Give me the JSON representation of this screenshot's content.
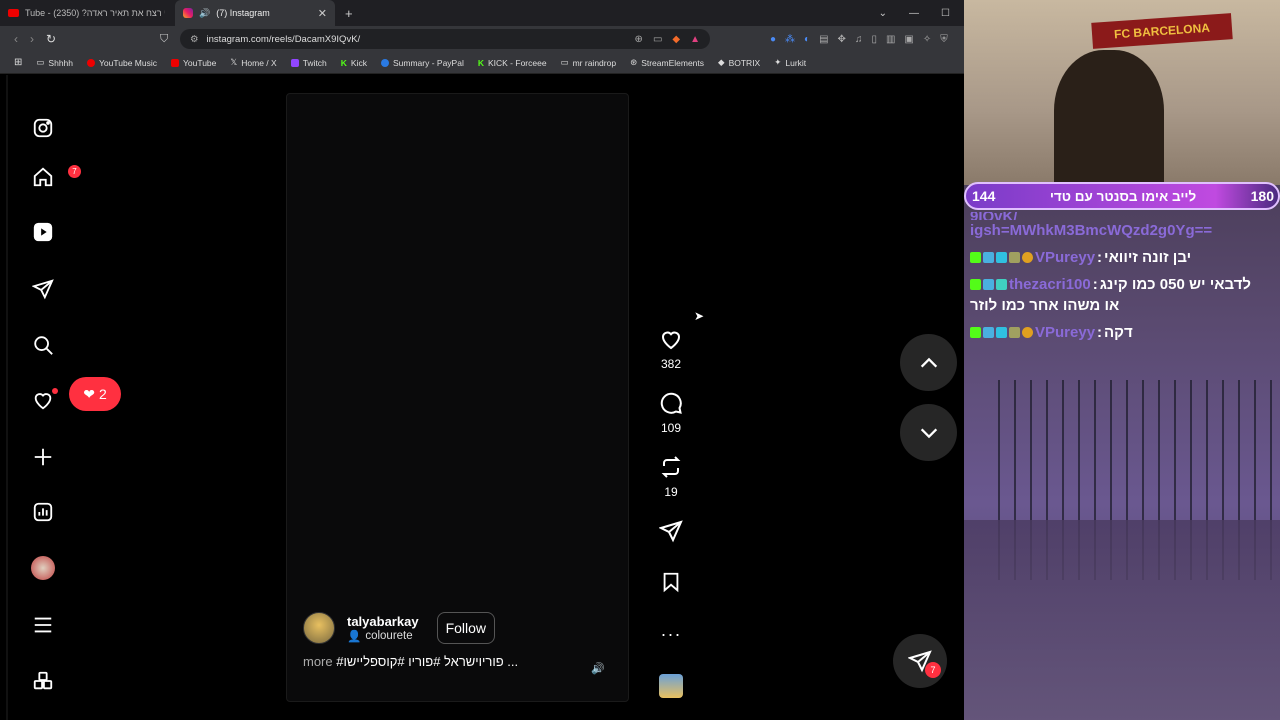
{
  "tabs": [
    {
      "title": "Tube - מי רצח את תאיר ראדה? (2350)"
    },
    {
      "title": "(7) Instagram"
    }
  ],
  "address": "instagram.com/reels/DacamX9IQvK/",
  "bookmarks": [
    "Shhhh",
    "YouTube Music",
    "YouTube",
    "Home / X",
    "Twitch",
    "Kick",
    "Summary - PayPal",
    "KICK - Forceee",
    "mr raindrop",
    "StreamElements",
    "BOTRIX",
    "Lurkit"
  ],
  "sidebar": {
    "messages_badge": "7",
    "notif_count": "2"
  },
  "reel": {
    "username": "talyabarkay",
    "audio": "colourete",
    "follow_label": "Follow",
    "caption": "#פוריוישראל #פוריו #קוספליישו ...",
    "more_label": "more"
  },
  "actions": {
    "likes": "382",
    "comments": "109",
    "reposts": "19"
  },
  "fab_badge": "7",
  "overlay": {
    "scarf_text": "FC BARCELONA",
    "goal_left": "144",
    "goal_text": "לייב אימו בסנטר עם טדי",
    "goal_right": "180",
    "chat": [
      {
        "nick": "",
        "msg": "9IQvK/"
      },
      {
        "nick": "",
        "msg": "igsh=MWhkM3BmcWQzd2g0Yg=="
      },
      {
        "nick": "VPureyy",
        "msg": "יבן זונה זיוואי"
      },
      {
        "nick": "thezacri100",
        "msg": "לדבאי יש 050 כמו קינג"
      },
      {
        "nick": "",
        "msg": "או משהו אחר כמו לוזר"
      },
      {
        "nick": "VPureyy",
        "msg": "דקה"
      }
    ]
  },
  "colors": {
    "accent": "#ff3040",
    "goal": "#b040e0",
    "chat_nick": "#8a6ad8"
  }
}
